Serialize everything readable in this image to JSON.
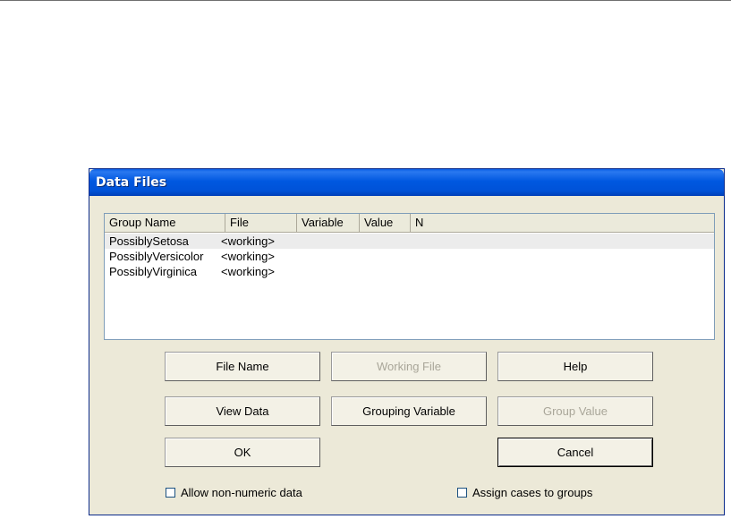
{
  "window": {
    "title": "Data Files"
  },
  "list": {
    "columns": [
      "Group Name",
      "File",
      "Variable",
      "Value",
      "N"
    ],
    "rows": [
      {
        "group": "PossiblySetosa",
        "file": "<working>"
      },
      {
        "group": "PossiblyVersicolor",
        "file": "<working>"
      },
      {
        "group": "PossiblyVirginica",
        "file": "<working>"
      }
    ],
    "selected_row": 0
  },
  "buttons": {
    "file_name": "File Name",
    "working_file": "Working File",
    "help": "Help",
    "view_data": "View Data",
    "grouping_variable": "Grouping Variable",
    "group_value": "Group Value",
    "ok": "OK",
    "cancel": "Cancel"
  },
  "options": {
    "allow_non_numeric": {
      "label": "Allow non-numeric data",
      "checked": false
    },
    "assign_cases": {
      "label": "Assign cases to groups",
      "checked": false
    }
  },
  "colors": {
    "title_bar": "#0058e0",
    "dialog_bg": "#ece9d8",
    "disabled_text": "#a9a699"
  }
}
